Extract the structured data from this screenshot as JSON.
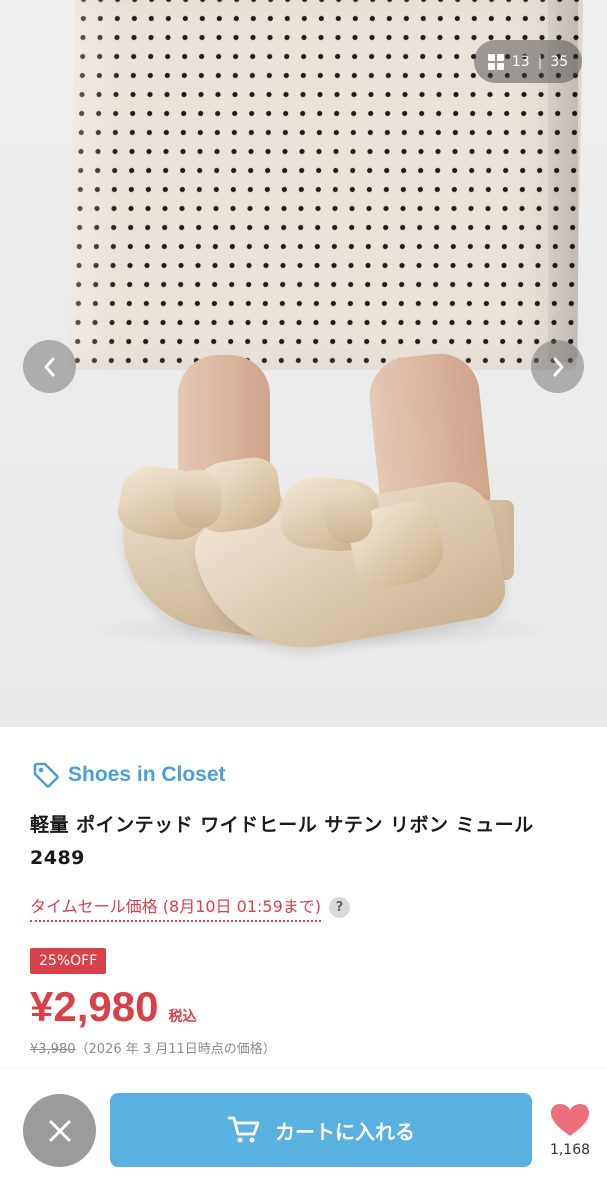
{
  "gallery": {
    "current": "13",
    "separator": "|",
    "total": "35",
    "grid_icon": "grid-icon",
    "prev_icon": "chevron-left-icon",
    "next_icon": "chevron-right-icon"
  },
  "product": {
    "brand": "Shoes in Closet",
    "brand_icon": "tag-icon",
    "title": "軽量 ポインテッド ワイドヒール サテン リボン ミュール 2489",
    "timesale_label": "タイムセール価格 (8月10日 01:59まで)",
    "help_icon_text": "?",
    "discount_badge": "25%OFF",
    "price": "¥2,980",
    "tax_label": "税込",
    "original_price": "¥3,980",
    "price_reference_note": "（2026 年 3 月11日時点の価格）"
  },
  "actions": {
    "close_icon": "close-icon",
    "cart_icon": "cart-icon",
    "cart_label": "カートに入れる",
    "favorite_icon": "heart-icon",
    "favorite_count": "1,168"
  },
  "colors": {
    "brand_blue": "#4a9fd8",
    "sale_red": "#d8414a",
    "cart_blue": "#59b1e2",
    "heart_pink": "#ee6f7c",
    "close_gray": "#9b9b9b"
  }
}
